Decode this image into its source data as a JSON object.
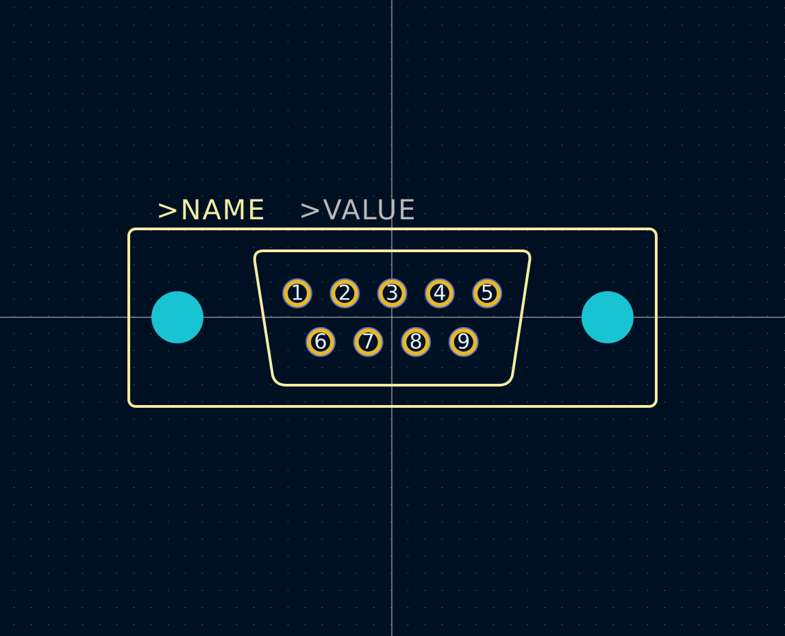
{
  "footprint": {
    "reference_label": ">NAME",
    "value_label": ">VALUE",
    "pads_row1": [
      "1",
      "2",
      "3",
      "4",
      "5"
    ],
    "pads_row2": [
      "6",
      "7",
      "8",
      "9"
    ],
    "mounting_holes": 2
  },
  "colors": {
    "background": "#001023",
    "grid": "#84848a",
    "crosshair": "#c8c8c8",
    "silkscreen": "#f2eda1",
    "value_text": "#b8b8b8",
    "pad": "#e4b830",
    "pad_outline": "#5a6fb8",
    "mounting_hole": "#19c4d2"
  }
}
